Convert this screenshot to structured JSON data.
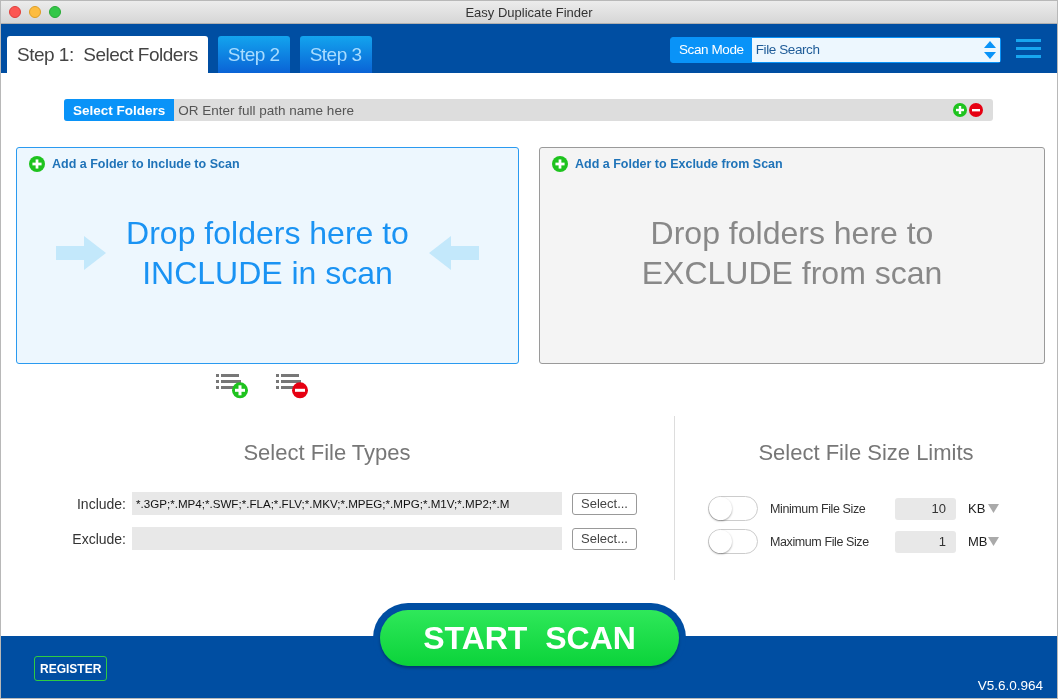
{
  "window": {
    "title": "Easy Duplicate Finder"
  },
  "tabs": [
    {
      "label": "Step 1:  Select Folders",
      "selected": true
    },
    {
      "label": "Step 2",
      "selected": false
    },
    {
      "label": "Step 3",
      "selected": false
    }
  ],
  "scan_mode": {
    "label": "Scan Mode",
    "value": "File Search"
  },
  "path_bar": {
    "button": "Select Folders",
    "placeholder": "OR Enter full path name here"
  },
  "panels": [
    {
      "kind": "include",
      "header": "Add a Folder to Include to Scan",
      "lines": [
        "Drop folders here to",
        "INCLUDE in scan"
      ]
    },
    {
      "kind": "exclude",
      "header": "Add a Folder to Exclude from Scan",
      "lines": [
        "Drop folders here to",
        "EXCLUDE from scan"
      ]
    }
  ],
  "file_types": {
    "title": "Select File Types",
    "rows": [
      {
        "label": "Include:",
        "value": "*.3GP;*.MP4;*.SWF;*.FLA;*.FLV;*.MKV;*.MPEG;*.MPG;*.M1V;*.MP2;*.M",
        "button": "Select..."
      },
      {
        "label": "Exclude:",
        "button": "Select..."
      }
    ]
  },
  "size_limits": {
    "title": "Select File Size Limits",
    "rows": [
      {
        "label": "Minimum File Size",
        "on": false,
        "value": "10",
        "unit": "KB"
      },
      {
        "label": "Maximum File Size",
        "on": false,
        "value": "1",
        "unit": "MB"
      }
    ]
  },
  "start_button": "START  SCAN",
  "register_button": "REGISTER",
  "version": "V5.6.0.964"
}
